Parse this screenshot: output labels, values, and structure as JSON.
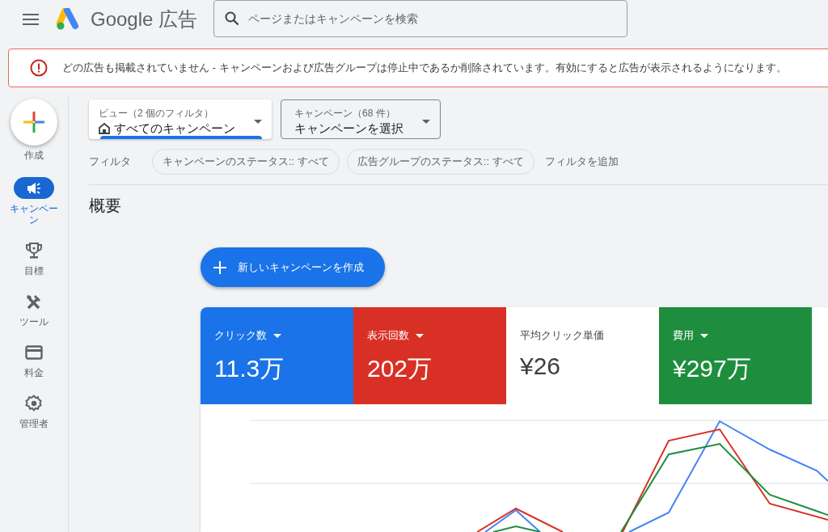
{
  "header": {
    "product": "Google",
    "product_suffix": "広告",
    "search": {
      "placeholder": "ページまたはキャンペーンを検索"
    }
  },
  "alert": {
    "message": "どの広告も掲載されていません - キャンペーンおよび広告グループは停止中であるか削除されています。有効にすると広告が表示されるようになります。"
  },
  "sidebar": {
    "create": {
      "label": "作成"
    },
    "items": [
      {
        "label": "キャンペーン",
        "selected": true
      },
      {
        "label": "目標",
        "selected": false
      },
      {
        "label": "ツール",
        "selected": false
      },
      {
        "label": "料金",
        "selected": false
      },
      {
        "label": "管理者",
        "selected": false
      }
    ]
  },
  "selectors": [
    {
      "label": "ビュー（2 個のフィルタ）",
      "value": "すべてのキャンペーン",
      "selected": true
    },
    {
      "label": "キャンペーン（68 件）",
      "value": "キャンペーンを選択",
      "selected": false
    }
  ],
  "filters": {
    "label": "フィルタ",
    "chips": [
      "キャンペーンのステータス:: すべて",
      "広告グループのステータス:: すべて"
    ],
    "add": "フィルタを追加"
  },
  "section_title": "概要",
  "new_campaign_button": "新しいキャンペーンを作成",
  "metrics": [
    {
      "label": "クリック数",
      "value": "11.3万",
      "selected": true,
      "color": "#1a73e8"
    },
    {
      "label": "表示回数",
      "value": "202万",
      "selected": true,
      "color": "#d93025"
    },
    {
      "label": "平均クリック単価",
      "value": "¥26",
      "selected": false,
      "color": "#ffffff"
    },
    {
      "label": "費用",
      "value": "¥297万",
      "selected": true,
      "color": "#1e8e3e"
    }
  ]
}
